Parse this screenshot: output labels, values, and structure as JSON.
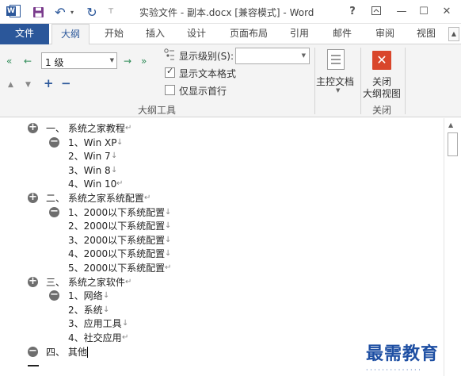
{
  "window": {
    "title": "实验文件 - 副本.docx [兼容模式] - Word",
    "help": "?",
    "min": "—",
    "max": "☐",
    "close": "✕",
    "ribbon_options": "⊼"
  },
  "quick_access": {
    "word_logo": "W",
    "save_icon": "save-icon",
    "undo": "↶",
    "undo_more": "▾",
    "redo": "↻",
    "customize": "⊤"
  },
  "tabs": {
    "file": "文件",
    "outline": "大纲",
    "start": "开始",
    "insert": "插入",
    "design": "设计",
    "layout": "页面布局",
    "references": "引用",
    "mailings": "邮件",
    "review": "审阅",
    "view": "视图"
  },
  "ribbon": {
    "promote_top": "«",
    "promote": "←",
    "level_value": "1 级",
    "demote": "→",
    "demote_body": "»",
    "move_up": "▲",
    "move_down": "▼",
    "expand": "+",
    "collapse": "−",
    "show_level_label": "显示级别(S):",
    "show_level_value": "",
    "show_text_format_label": "显示文本格式",
    "show_text_format_checked": true,
    "show_first_line_label": "仅显示首行",
    "show_first_line_checked": false,
    "outline_tools_label": "大纲工具",
    "master_doc_label": "主控文档",
    "close_outline_line1": "关闭",
    "close_outline_line2": "大纲视图",
    "close_group_label": "关闭"
  },
  "outline": [
    {
      "level": 1,
      "symbol": "+",
      "text": "一、 系统之家教程",
      "mark": "↵"
    },
    {
      "level": 2,
      "symbol": "−",
      "text": "1、Win XP",
      "mark": "↓"
    },
    {
      "level": 2,
      "symbol": "",
      "text": "2、Win 7",
      "mark": "↓"
    },
    {
      "level": 2,
      "symbol": "",
      "text": "3、Win 8",
      "mark": "↓"
    },
    {
      "level": 2,
      "symbol": "",
      "text": "4、Win 10",
      "mark": "↵"
    },
    {
      "level": 1,
      "symbol": "+",
      "text": "二、 系统之家系统配置",
      "mark": "↵"
    },
    {
      "level": 2,
      "symbol": "−",
      "text": "1、2000以下系统配置",
      "mark": "↓"
    },
    {
      "level": 2,
      "symbol": "",
      "text": "2、2000以下系统配置",
      "mark": "↓"
    },
    {
      "level": 2,
      "symbol": "",
      "text": "3、2000以下系统配置",
      "mark": "↓"
    },
    {
      "level": 2,
      "symbol": "",
      "text": "4、2000以下系统配置",
      "mark": "↓"
    },
    {
      "level": 2,
      "symbol": "",
      "text": "5、2000以下系统配置",
      "mark": "↵"
    },
    {
      "level": 1,
      "symbol": "+",
      "text": "三、 系统之家软件",
      "mark": "↵"
    },
    {
      "level": 2,
      "symbol": "−",
      "text": "1、网络",
      "mark": "↓"
    },
    {
      "level": 2,
      "symbol": "",
      "text": "2、系统",
      "mark": "↓"
    },
    {
      "level": 2,
      "symbol": "",
      "text": "3、应用工具",
      "mark": "↓"
    },
    {
      "level": 2,
      "symbol": "",
      "text": "4、社交应用",
      "mark": "↵"
    },
    {
      "level": 1,
      "symbol": "−",
      "text": "四、 其他",
      "mark": ""
    }
  ],
  "watermark": "最需教育"
}
